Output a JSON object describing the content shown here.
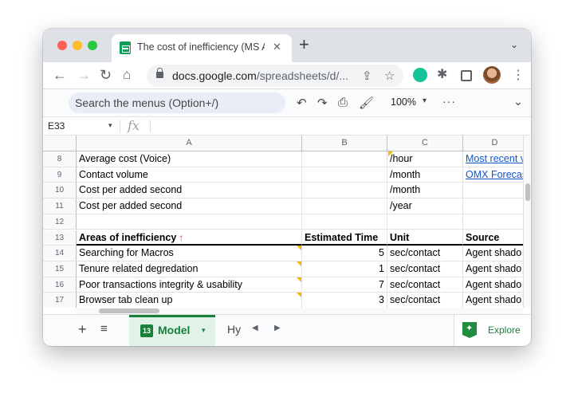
{
  "tab": {
    "title": "The cost of inefficiency (MS A",
    "close": "✕",
    "new": "+",
    "search": "⌄"
  },
  "address": {
    "host": "docs.google.com",
    "path": "/spreadsheets/d/..."
  },
  "toolbar": {
    "search_menus": "Search the menus (Option+/)",
    "zoom": "100%",
    "zoom_caret": "▾",
    "more": "···",
    "collapse": "⌄"
  },
  "formula": {
    "cell_ref": "E33",
    "fx": "fx",
    "caret": "▾",
    "value": ""
  },
  "columns": [
    {
      "label": "",
      "w": 0
    },
    {
      "label": "A"
    },
    {
      "label": "B"
    },
    {
      "label": "C"
    },
    {
      "label": "D"
    }
  ],
  "rows": [
    {
      "num": "8",
      "a": "Average cost (Voice)",
      "b": "",
      "c": "/hour",
      "d": "Most recent v",
      "d_link": true
    },
    {
      "num": "9",
      "a": "Contact volume",
      "b": "",
      "c": "/month",
      "d": "OMX Forecas",
      "d_link": true
    },
    {
      "num": "10",
      "a": "Cost per added second",
      "b": "",
      "c": "/month",
      "d": ""
    },
    {
      "num": "11",
      "a": "Cost per added second",
      "b": "",
      "c": "/year",
      "d": ""
    },
    {
      "num": "12",
      "a": "",
      "b": "",
      "c": "",
      "d": ""
    },
    {
      "num": "13",
      "a": "Areas of inefficiency",
      "a_arrow": "↑",
      "b": "Estimated Time",
      "c": "Unit",
      "d": "Source",
      "header": true
    },
    {
      "num": "14",
      "a": "Searching for Macros",
      "b": "5",
      "c": "sec/contact",
      "d": "Agent shado"
    },
    {
      "num": "15",
      "a": "Tenure related degredation",
      "b": "1",
      "c": "sec/contact",
      "d": "Agent shado"
    },
    {
      "num": "16",
      "a": "Poor transactions integrity & usability",
      "b": "7",
      "c": "sec/contact",
      "d": "Agent shado"
    },
    {
      "num": "17",
      "a": "Browser tab clean up",
      "b": "3",
      "c": "sec/contact",
      "d": "Agent shado"
    }
  ],
  "sheets": {
    "active_badge": "13",
    "active_name": "Model",
    "active_caret": "▾",
    "next_name": "Hy",
    "add": "+",
    "list": "≡",
    "prev_arrow": "◀",
    "next_arrow": "▶"
  },
  "explore": {
    "label": "Explore"
  },
  "colors": {
    "accent_green": "#188038",
    "link_blue": "#1155cc",
    "note_yellow": "#f4b400",
    "red_arrow": "#d93025"
  }
}
